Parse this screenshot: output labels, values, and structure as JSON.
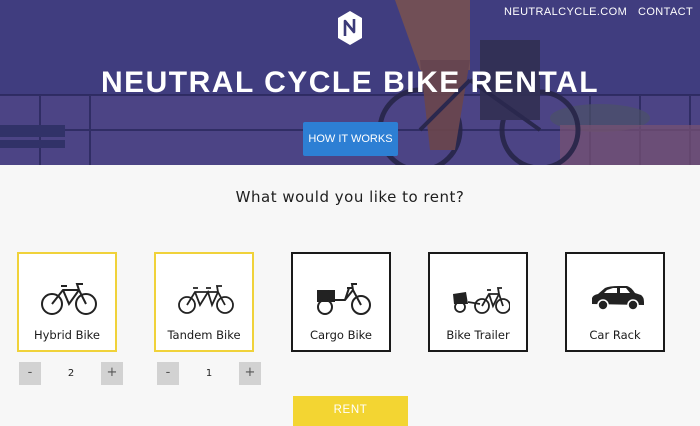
{
  "header": {
    "nav": [
      "NEUTRALCYCLE.COM",
      "CONTACT"
    ],
    "title": "NEUTRAL CYCLE BIKE RENTAL",
    "cta_label": "HOW IT WORKS",
    "accent": "#2d7fd4"
  },
  "main": {
    "question": "What would you like to rent?",
    "options": [
      {
        "label": "Hybrid Bike",
        "icon": "hybrid-bike-icon",
        "selected": true,
        "quantity": "2"
      },
      {
        "label": "Tandem Bike",
        "icon": "tandem-bike-icon",
        "selected": true,
        "quantity": "1"
      },
      {
        "label": "Cargo Bike",
        "icon": "cargo-bike-icon",
        "selected": false
      },
      {
        "label": "Bike Trailer",
        "icon": "bike-trailer-icon",
        "selected": false
      },
      {
        "label": "Car Rack",
        "icon": "car-icon",
        "selected": false
      }
    ],
    "stepper": {
      "minus": "-",
      "plus": "+"
    },
    "rent_label": "RENT",
    "selected_color": "#f0d23a",
    "rent_color": "#f3d532"
  }
}
